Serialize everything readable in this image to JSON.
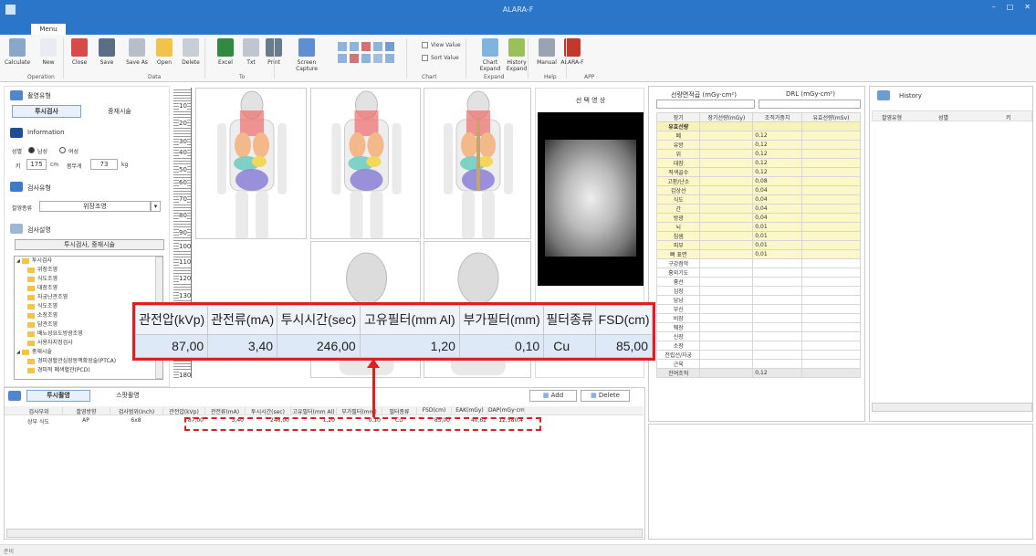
{
  "window": {
    "title": "ALARA-F"
  },
  "menu": {
    "tab": "Menu"
  },
  "ribbon": {
    "buttons": [
      {
        "label": "Calculate",
        "icon": "calculate-icon",
        "color": "#8aa7c7"
      },
      {
        "label": "New",
        "icon": "new-file-icon",
        "color": "#e8ecf2"
      },
      {
        "label": "Close",
        "icon": "close-icon",
        "color": "#d64a4a"
      },
      {
        "label": "Save",
        "icon": "save-icon",
        "color": "#5a6e86"
      },
      {
        "label": "Save As",
        "icon": "save-as-icon",
        "color": "#b7bec8"
      },
      {
        "label": "Open",
        "icon": "open-folder-icon",
        "color": "#f1c24c"
      },
      {
        "label": "Delete",
        "icon": "delete-icon",
        "color": "#c9ced6"
      },
      {
        "label": "Excel",
        "icon": "excel-icon",
        "color": "#2f8a3f"
      },
      {
        "label": "Txt",
        "icon": "txt-icon",
        "color": "#bfc6cf"
      },
      {
        "label": "Print",
        "icon": "print-icon",
        "color": "#6b7b8e"
      },
      {
        "label": "Screen\nCapture",
        "icon": "screen-capture-icon",
        "color": "#5d8fd2"
      },
      {
        "label": "Chart\nExpand",
        "icon": "chart-expand-icon",
        "color": "#7eb4e2"
      },
      {
        "label": "History\nExpand",
        "icon": "history-expand-icon",
        "color": "#9bbf5a"
      },
      {
        "label": "Manual",
        "icon": "manual-icon",
        "color": "#9aa4b0"
      },
      {
        "label": "ALARA-F",
        "icon": "alara-icon",
        "color": "#c0392b"
      }
    ],
    "checks": [
      "View Value",
      "Sort Value"
    ],
    "groups": [
      "Operation",
      "Data",
      "To",
      "Chart",
      "Expand",
      "Help",
      "APP"
    ]
  },
  "left": {
    "exam_type_header": "촬영유형",
    "tabs": [
      "투시검사",
      "중재시술"
    ],
    "info_header": "Information",
    "sex_label": "성별",
    "sex_options": [
      "남성",
      "여성"
    ],
    "height_label": "키",
    "height_value": "175",
    "height_unit": "cm",
    "weight_label": "몸무게",
    "weight_value": "73",
    "weight_unit": "kg",
    "exam_header": "검사유형",
    "exam_kind_label": "촬영종류",
    "exam_kind_value": "위장조영",
    "desc_header": "검사설명",
    "tree_title": "투시검사, 중재시술",
    "tree": [
      {
        "label": "투시검사",
        "level": 0
      },
      {
        "label": "위장조영",
        "level": 1
      },
      {
        "label": "식도조영",
        "level": 1
      },
      {
        "label": "대장조영",
        "level": 1
      },
      {
        "label": "자궁난관조영",
        "level": 1
      },
      {
        "label": "식도조영",
        "level": 1
      },
      {
        "label": "소장조영",
        "level": 1
      },
      {
        "label": "담관조영",
        "level": 1
      },
      {
        "label": "배뇨성요도방광조영",
        "level": 1
      },
      {
        "label": "사용자지정검사",
        "level": 1
      },
      {
        "label": "중재시술",
        "level": 0
      },
      {
        "label": "경피경혈관심장동맥확장술(PTCA)",
        "level": 1
      },
      {
        "label": "경피적 폐색혈관(PCD)",
        "level": 1
      }
    ]
  },
  "ruler_labels": [
    "10",
    "20",
    "30",
    "40",
    "50",
    "60",
    "70",
    "80",
    "90",
    "100",
    "110",
    "120",
    "130",
    "180"
  ],
  "preview": {
    "title": "선 택 영 상"
  },
  "callout": {
    "headers": [
      "관전압(kVp)",
      "관전류(mA)",
      "투시시간(sec)",
      "고유필터(mm Al)",
      "부가필터(mm)",
      "필터종류",
      "FSD(cm)"
    ],
    "values": [
      "87,00",
      "3,40",
      "246,00",
      "1,20",
      "0,10",
      "Cu",
      "85,00"
    ]
  },
  "bottom": {
    "tabs": [
      "투시촬영",
      "스팟촬영"
    ],
    "add_label": "Add",
    "delete_label": "Delete",
    "columns": [
      "검사부위",
      "촬영방향",
      "검사범위(Inch)",
      "관전압(kVp)",
      "관전류(mA)",
      "투시시간(sec)",
      "고유필터(mm Al)",
      "부가필터(mm)",
      "필터종류",
      "FSD(cm)",
      "EAK(mGy)",
      "DAP(mGy·cm²)"
    ],
    "rows": [
      [
        "상부 식도",
        "AP",
        "6x8",
        "87,00",
        "3,40",
        "246,00",
        "1,20",
        "0,10",
        "Cu",
        "85,00",
        "40,62",
        "12,580,4"
      ]
    ]
  },
  "dose": {
    "area_label": "선량면적곱 (mGy·cm²)",
    "drl_label": "DRL (mGy·cm²)",
    "headers": [
      "장기",
      "장기선량(mGy)",
      "조직가중치",
      "유효선량(mSv)"
    ],
    "section": "유효선량",
    "rows": [
      [
        "폐",
        "",
        "0,12",
        ""
      ],
      [
        "유방",
        "",
        "0,12",
        ""
      ],
      [
        "위",
        "",
        "0,12",
        ""
      ],
      [
        "대장",
        "",
        "0,12",
        ""
      ],
      [
        "적색골수",
        "",
        "0,12",
        ""
      ],
      [
        "고환/난소",
        "",
        "0,08",
        ""
      ],
      [
        "갑상선",
        "",
        "0,04",
        ""
      ],
      [
        "식도",
        "",
        "0,04",
        ""
      ],
      [
        "간",
        "",
        "0,04",
        ""
      ],
      [
        "방광",
        "",
        "0,04",
        ""
      ],
      [
        "뇌",
        "",
        "0,01",
        ""
      ],
      [
        "침샘",
        "",
        "0,01",
        ""
      ],
      [
        "피부",
        "",
        "0,01",
        ""
      ],
      [
        "뼈 표면",
        "",
        "0,01",
        ""
      ],
      [
        "구강점막",
        "",
        "",
        ""
      ],
      [
        "흉외기도",
        "",
        "",
        ""
      ],
      [
        "흉선",
        "",
        "",
        ""
      ],
      [
        "심장",
        "",
        "",
        ""
      ],
      [
        "담낭",
        "",
        "",
        ""
      ],
      [
        "부신",
        "",
        "",
        ""
      ],
      [
        "비장",
        "",
        "",
        ""
      ],
      [
        "췌장",
        "",
        "",
        ""
      ],
      [
        "신장",
        "",
        "",
        ""
      ],
      [
        "소장",
        "",
        "",
        ""
      ],
      [
        "전립선/자궁",
        "",
        "",
        ""
      ],
      [
        "근육",
        "",
        "",
        ""
      ],
      [
        "잔여조직",
        "",
        "0,12",
        ""
      ]
    ]
  },
  "history": {
    "title": "History",
    "columns": [
      "촬영유형",
      "성별",
      "키"
    ]
  },
  "status": {
    "text": "준비"
  }
}
